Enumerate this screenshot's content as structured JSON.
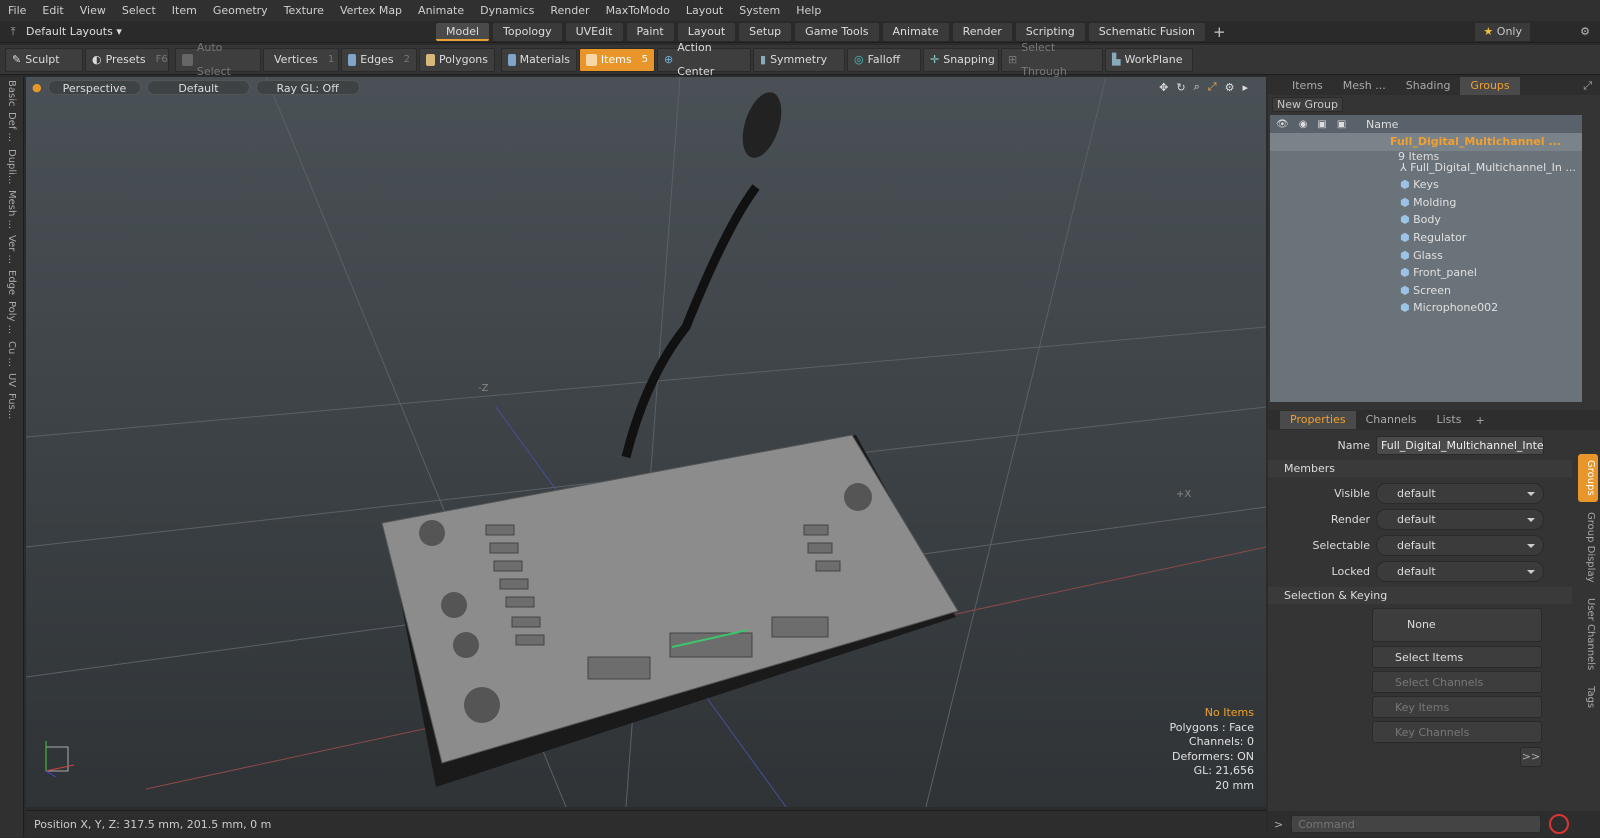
{
  "menu": [
    "File",
    "Edit",
    "View",
    "Select",
    "Item",
    "Geometry",
    "Texture",
    "Vertex Map",
    "Animate",
    "Dynamics",
    "Render",
    "MaxToModo",
    "Layout",
    "System",
    "Help"
  ],
  "layout_selector": "Default Layouts",
  "tabs": [
    "Model",
    "Topology",
    "UVEdit",
    "Paint",
    "Layout",
    "Setup",
    "Game Tools",
    "Animate",
    "Render",
    "Scripting",
    "Schematic Fusion"
  ],
  "only_label": "Only",
  "toolbar": {
    "sculpt": "Sculpt",
    "presets": "Presets",
    "presets_key": "F6",
    "auto_select": "Auto Select",
    "vertices": "Vertices",
    "vertices_key": "1",
    "edges": "Edges",
    "edges_key": "2",
    "polygons": "Polygons",
    "materials": "Materials",
    "items": "Items",
    "items_key": "5",
    "action_center": "Action Center",
    "symmetry": "Symmetry",
    "falloff": "Falloff",
    "snapping": "Snapping",
    "select_through": "Select Through",
    "workplane": "WorkPlane"
  },
  "left_tabs": [
    "Basic",
    "Def ...",
    "Dupli...",
    "Mesh ...",
    "Ver ...",
    "Edge",
    "Poly ...",
    "Cu ...",
    "UV",
    "Fus..."
  ],
  "viewport": {
    "view": "Perspective",
    "shading": "Default",
    "raygl": "Ray GL: Off",
    "axis_z": "-Z",
    "axis_x": "+X"
  },
  "stats": {
    "items": "No Items",
    "polygons": "Polygons : Face",
    "channels": "Channels: 0",
    "deformers": "Deformers: ON",
    "gl": "GL: 21,656",
    "scale": "20 mm"
  },
  "status": "Position X, Y, Z:  317.5 mm, 201.5 mm, 0 m",
  "groups_panel": {
    "tabs": [
      "Items",
      "Mesh ...",
      "Shading",
      "Groups"
    ],
    "new_group": "New Group",
    "name_header": "Name",
    "group_name": "Full_Digital_Multichannel ...",
    "group_count": "9 Items",
    "members": [
      "Full_Digital_Multichannel_In ...",
      "Keys",
      "Molding",
      "Body",
      "Regulator",
      "Glass",
      "Front_panel",
      "Screen",
      "Microphone002"
    ]
  },
  "properties": {
    "tabs": [
      "Properties",
      "Channels",
      "Lists"
    ],
    "name_label": "Name",
    "name_value": "Full_Digital_Multichannel_Interpre",
    "members_section": "Members",
    "visible_label": "Visible",
    "visible": "default",
    "render_label": "Render",
    "render": "default",
    "selectable_label": "Selectable",
    "selectable": "default",
    "locked_label": "Locked",
    "locked": "default",
    "selkey_section": "Selection & Keying",
    "none": "None",
    "select_items": "Select Items",
    "select_channels": "Select Channels",
    "key_items": "Key Items",
    "key_channels": "Key Channels",
    "more": ">>"
  },
  "side_tabs": [
    "Groups",
    "Group Display",
    "User Channels",
    "Tags"
  ],
  "command_placeholder": "Command",
  "accent": "#e8962a"
}
